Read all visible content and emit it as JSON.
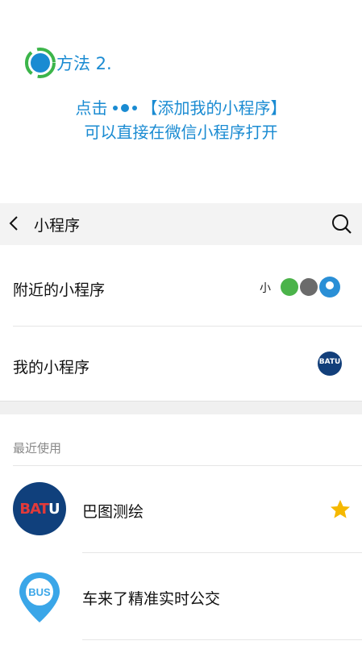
{
  "method": {
    "title": "方法 2."
  },
  "instructions": {
    "line1_prefix": "点击",
    "line1_suffix": "【添加我的小程序】",
    "line2": "可以直接在微信小程序打开"
  },
  "navbar": {
    "title": "小程序",
    "back_icon": "chevron-left-icon",
    "search_icon": "search-icon"
  },
  "rows": [
    {
      "label": "附近的小程序"
    },
    {
      "label": "我的小程序"
    }
  ],
  "section": {
    "recent_label": "最近使用"
  },
  "recent_apps": [
    {
      "name": "巴图测绘",
      "logo_text": "BATU",
      "starred": true
    },
    {
      "name": "车来了精准实时公交",
      "logo_text": "BUS"
    }
  ],
  "colors": {
    "accent": "#1a8bd2",
    "batu_blue": "#10407c",
    "star": "#f5b800"
  }
}
